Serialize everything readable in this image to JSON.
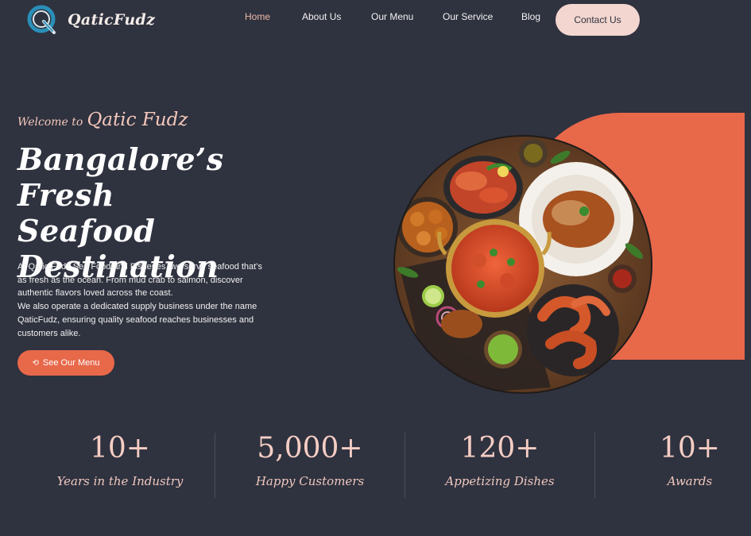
{
  "brand": {
    "name": "QaticFudz",
    "logo_icon": "q-logo-icon"
  },
  "nav": {
    "items": [
      {
        "label": "Home",
        "active": true
      },
      {
        "label": "About Us"
      },
      {
        "label": "Our Menu"
      },
      {
        "label": "Our Service"
      },
      {
        "label": "Blog"
      }
    ],
    "contact_label": "Contact Us"
  },
  "hero": {
    "welcome_prefix": "Welcome to",
    "welcome_name": "Qatic Fudz",
    "headline_line1": "Bangalore’s Fresh",
    "headline_line2": "Seafood",
    "headline_line3": "Destination",
    "paragraph1": "At Qatic Fudz Sea Food and Fisheries, we serve seafood that’s as fresh as the ocean. From mud crab to salmon, discover authentic flavors loved across the coast.",
    "paragraph2": "We also operate a dedicated supply business under the name QaticFudz, ensuring quality seafood reaches businesses and customers alike.",
    "cta_label": "See Our Menu",
    "cta_icon": "menu-icon"
  },
  "stats": [
    {
      "value": "10+",
      "label": "Years in the Industry"
    },
    {
      "value": "5,000+",
      "label": "Happy Customers"
    },
    {
      "value": "120+",
      "label": "Appetizing Dishes"
    },
    {
      "value": "10+",
      "label": "Awards"
    }
  ],
  "colors": {
    "background": "#2f323f",
    "accent": "#e8684a",
    "contact_bg": "#f3d6d0",
    "stat_text": "#f5cdc4"
  }
}
